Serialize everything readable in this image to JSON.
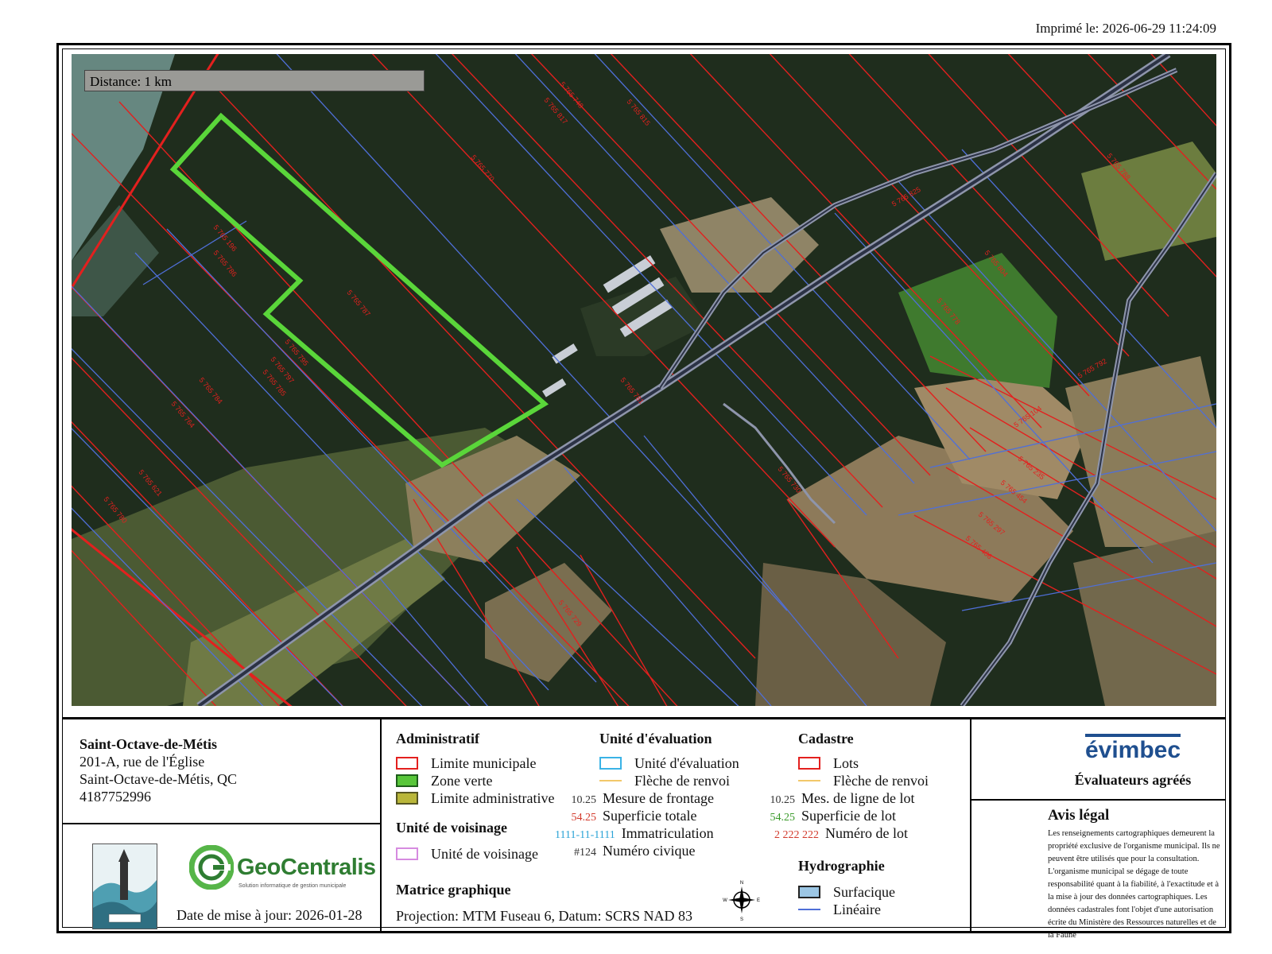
{
  "header": {
    "printed": "Imprimé le: 2026-06-29 11:24:09"
  },
  "map": {
    "scale": "Distance: 1 km",
    "lot_labels": [
      "5 765 196",
      "5 765 787",
      "5 765 786",
      "5 765 795",
      "5 765 797",
      "5 765 784",
      "5 765 764",
      "5 765 785",
      "5 765 621",
      "5 765 780",
      "5 765 817",
      "5 765 815",
      "5 765 770",
      "5 765 748",
      "5 765 804",
      "5 765 778",
      "5 765 104",
      "5 765 235",
      "5 765 454",
      "5 765 297",
      "5 765 406",
      "5 765 781",
      "5 765 825",
      "5 765 792",
      "5 765 788",
      "5 765 729",
      "5 765 730"
    ],
    "colors": {
      "lot_line": "#e3201e",
      "unit_line": "#4f6fd8",
      "zone_verte": "#5ad63a",
      "road": "#8e95ab"
    }
  },
  "municipality": {
    "name": "Saint-Octave-de-Métis",
    "address1": "201-A, rue de l'Église",
    "address2": "Saint-Octave-de-Métis, QC",
    "phone": "4187752996"
  },
  "logos": {
    "crest_icon": "municipal-crest-icon",
    "geocentralis_name": "GeoCentralis",
    "geocentralis_tagline": "Solution informatique de gestion municipale",
    "update_date": "Date de mise à jour: 2026-01-28"
  },
  "legend": {
    "administratif": {
      "title": "Administratif",
      "items": [
        {
          "label": "Limite municipale",
          "color": "#e3201e",
          "fill": "#ffffff"
        },
        {
          "label": "Zone verte",
          "color": "#1d5e1a",
          "fill": "#58c63a"
        },
        {
          "label": "Limite administrative",
          "color": "#555522",
          "fill": "#b9b63a"
        }
      ]
    },
    "voisinage": {
      "title": "Unité de voisinage",
      "items": [
        {
          "label": "Unité de voisinage",
          "color": "#d68be0"
        }
      ]
    },
    "matrice": {
      "title": "Matrice graphique",
      "projection": "Projection: MTM Fuseau 6, Datum: SCRS NAD 83"
    },
    "evaluation": {
      "title": "Unité d'évaluation",
      "unit_label": "Unité d'évaluation",
      "unit_color": "#3ab3e6",
      "arrow_label": "Flèche de renvoi",
      "frontage_num": "10.25",
      "frontage_label": "Mesure de frontage",
      "area_num": "54.25",
      "area_label": "Superficie totale",
      "reg_num": "1111-11-1111",
      "reg_label": "Immatriculation",
      "civic_num": "#124",
      "civic_label": "Numéro civique"
    },
    "cadastre": {
      "title": "Cadastre",
      "lots_label": "Lots",
      "arrow_label": "Flèche de renvoi",
      "line_num": "10.25",
      "line_label": "Mes. de ligne de lot",
      "area_num": "54.25",
      "area_label": "Superficie de lot",
      "lot_num": "2 222 222",
      "lot_label": "Numéro de lot"
    },
    "hydro": {
      "title": "Hydrographie",
      "surface_label": "Surfacique",
      "linear_label": "Linéaire"
    },
    "compass": {
      "n": "N",
      "s": "S",
      "e": "E",
      "w": "W"
    }
  },
  "evimbec": {
    "logo": "évimbec",
    "subtitle": "Évaluateurs agréés"
  },
  "avis": {
    "title": "Avis légal",
    "text": "Les renseignements cartographiques demeurent la propriété exclusive de l'organisme municipal. Ils ne peuvent être utilisés que pour la consultation. L'organisme municipal se dégage de toute responsabilité quant à la fiabilité, à l'exactitude et à la mise à jour des données cartographiques. Les données cadastrales font l'objet d'une autorisation écrite du Ministère des Ressources naturelles et de la Faune"
  }
}
